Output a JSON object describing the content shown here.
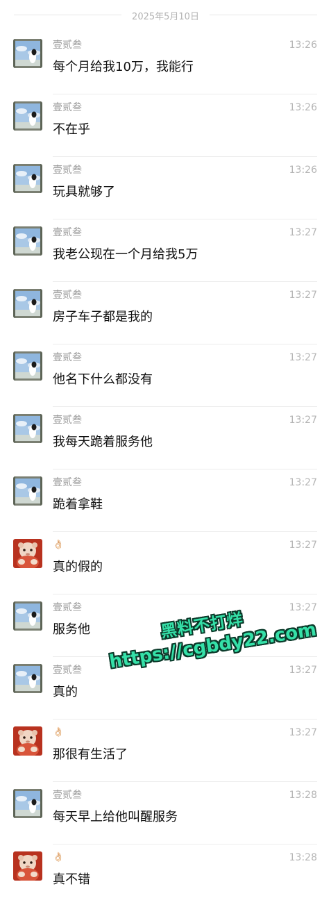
{
  "date_header": "2025年5月10日",
  "senders": {
    "a": "壹贰叁",
    "b": "👌🏻"
  },
  "messages": [
    {
      "sender": "a",
      "time": "13:26",
      "text": "每个月给我10万，我能行"
    },
    {
      "sender": "a",
      "time": "13:26",
      "text": "不在乎"
    },
    {
      "sender": "a",
      "time": "13:26",
      "text": "玩具就够了"
    },
    {
      "sender": "a",
      "time": "13:27",
      "text": "我老公现在一个月给我5万"
    },
    {
      "sender": "a",
      "time": "13:27",
      "text": "房子车子都是我的"
    },
    {
      "sender": "a",
      "time": "13:27",
      "text": "他名下什么都没有"
    },
    {
      "sender": "a",
      "time": "13:27",
      "text": "我每天跪着服务他"
    },
    {
      "sender": "a",
      "time": "13:27",
      "text": "跪着拿鞋"
    },
    {
      "sender": "b",
      "time": "13:27",
      "text": "真的假的"
    },
    {
      "sender": "a",
      "time": "13:27",
      "text": "服务他"
    },
    {
      "sender": "a",
      "time": "13:27",
      "text": "真的"
    },
    {
      "sender": "b",
      "time": "13:27",
      "text": "那很有生活了"
    },
    {
      "sender": "a",
      "time": "13:28",
      "text": "每天早上给他叫醒服务"
    },
    {
      "sender": "b",
      "time": "13:28",
      "text": "真不错"
    }
  ],
  "watermark": {
    "line1": "黑料不打烊",
    "line2": "https://cgbdy22.com"
  },
  "colors": {
    "sender_name": "#9a9a9a",
    "time": "#b5b5b5",
    "message_text": "#111111",
    "watermark_fill": "#35e0a8",
    "watermark_outline": "#0b3a2a"
  }
}
